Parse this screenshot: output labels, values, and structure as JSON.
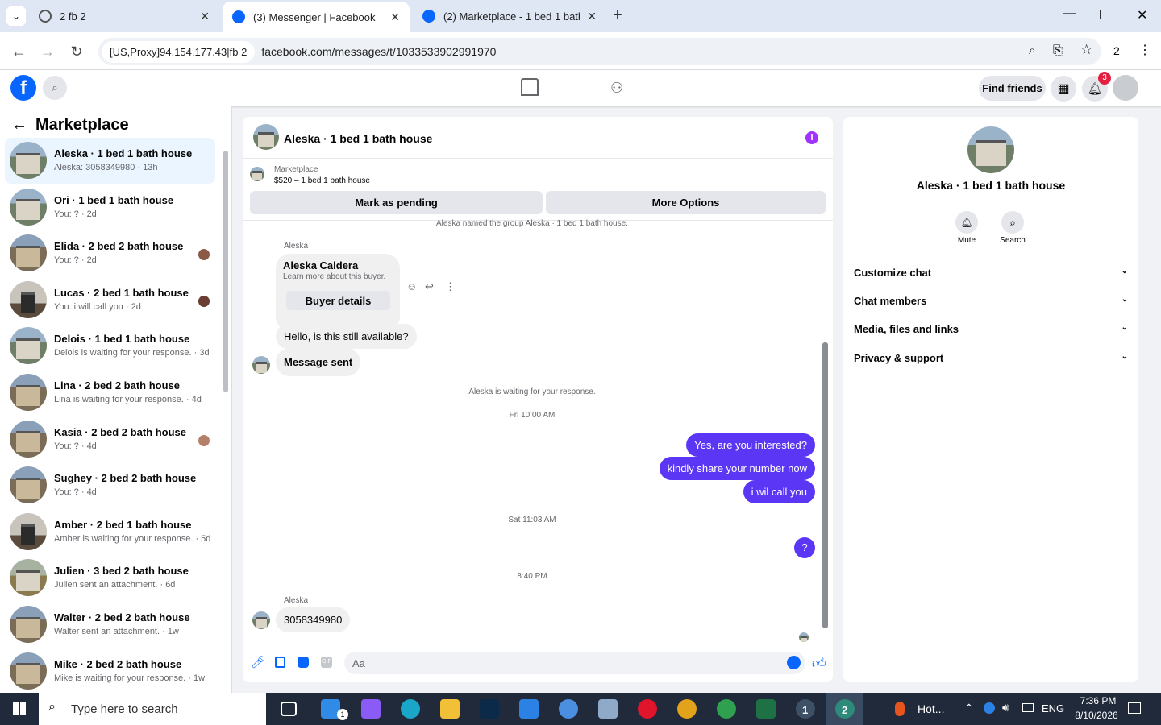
{
  "browser": {
    "tabs": [
      {
        "label": "2 fb 2"
      },
      {
        "label": "(3) Messenger | Facebook"
      },
      {
        "label": "(2) Marketplace - 1 bed 1 bath"
      }
    ],
    "site_chip": "[US,Proxy]94.154.177.43|fb 2",
    "url": "facebook.com/messages/t/1033533902991970",
    "profile_count": "2"
  },
  "fb": {
    "find_friends": "Find friends",
    "notif_count": "3"
  },
  "left": {
    "title": "Marketplace",
    "conversations": [
      {
        "name": "Aleska · 1 bed 1 bath house",
        "snippet": "Aleska: 3058349980 · 13h"
      },
      {
        "name": "Ori · 1 bed 1 bath house",
        "snippet": "You: ? · 2d"
      },
      {
        "name": "Elida · 2 bed 2 bath house",
        "snippet": "You: ? · 2d"
      },
      {
        "name": "Lucas · 2 bed 1 bath house",
        "snippet": "You: i will call you · 2d"
      },
      {
        "name": "Delois · 1 bed 1 bath house",
        "snippet": "Delois is waiting for your response. · 3d"
      },
      {
        "name": "Lina · 2 bed 2 bath house",
        "snippet": "Lina is waiting for your response. · 4d"
      },
      {
        "name": "Kasia · 2 bed 2 bath house",
        "snippet": "You: ? · 4d"
      },
      {
        "name": "Sughey · 2 bed 2 bath house",
        "snippet": "You: ? · 4d"
      },
      {
        "name": "Amber · 2 bed 1 bath house",
        "snippet": "Amber is waiting for your response. · 5d"
      },
      {
        "name": "Julien · 3 bed 2 bath house",
        "snippet": "Julien sent an attachment. · 6d"
      },
      {
        "name": "Walter · 2 bed 2 bath house",
        "snippet": "Walter sent an attachment. · 1w"
      },
      {
        "name": "Mike · 2 bed 2 bath house",
        "snippet": "Mike is waiting for your response. · 1w"
      }
    ]
  },
  "chat": {
    "title": "Aleska · 1 bed 1 bath house",
    "listing_source": "Marketplace",
    "listing_title": "$520 – 1 bed 1 bath house",
    "mark_pending": "Mark as pending",
    "more_options": "More Options",
    "group_named": "Aleska named the group Aleska · 1 bed 1 bath house.",
    "sender1": "Aleska",
    "buyer_name": "Aleska Caldera",
    "buyer_sub": "Learn more about this buyer.",
    "buyer_details": "Buyer details",
    "msg_available": "Hello, is this still available?",
    "msg_sent": "Message sent",
    "waiting": "Aleska is waiting for your response.",
    "time1": "Fri 10:00 AM",
    "out1": "Yes, are you interested?",
    "out2": "kindly share your number now",
    "out3": "i wil call you",
    "time2": "Sat 11:03 AM",
    "out4": "?",
    "time3": "8:40 PM",
    "sender2": "Aleska",
    "in_number": "3058349980",
    "composer_placeholder": "Aa"
  },
  "right": {
    "title": "Aleska · 1 bed 1 bath house",
    "mute": "Mute",
    "search": "Search",
    "sections": [
      "Customize chat",
      "Chat members",
      "Media, files and links",
      "Privacy & support"
    ]
  },
  "taskbar": {
    "search_placeholder": "Type here to search",
    "weather": "Hot...",
    "lang": "ENG",
    "time": "7:36 PM",
    "date": "8/10/2026",
    "mail_badge": "1",
    "app_badge1": "1",
    "app_badge2": "2"
  },
  "colors": {
    "fb_blue": "#0866ff",
    "outgoing": "#5b37f5",
    "accent_purple": "#a033ff"
  }
}
